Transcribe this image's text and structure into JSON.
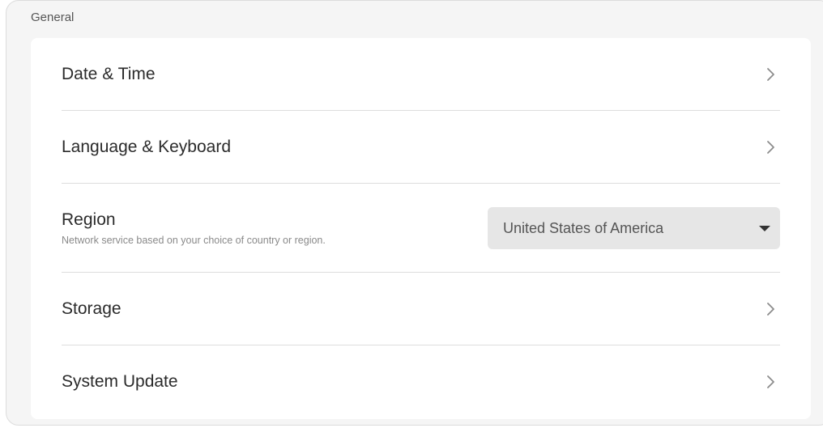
{
  "section": {
    "title": "General"
  },
  "items": [
    {
      "label": "Date & Time",
      "icon": "chevron-right-icon"
    },
    {
      "label": "Language & Keyboard",
      "icon": "chevron-right-icon"
    },
    {
      "label": "Region",
      "subtitle": "Network service based on your choice of country or region.",
      "select_value": "United States of America",
      "icon": "caret-down-icon"
    },
    {
      "label": "Storage",
      "icon": "chevron-right-icon"
    },
    {
      "label": "System Update",
      "icon": "chevron-right-icon"
    }
  ],
  "colors": {
    "panel_bg": "#f5f5f5",
    "card_bg": "#ffffff",
    "select_bg": "#e6e6e6",
    "text": "#2b2b2b",
    "muted": "#8a8a8a",
    "chevron": "#8c8c8c"
  }
}
